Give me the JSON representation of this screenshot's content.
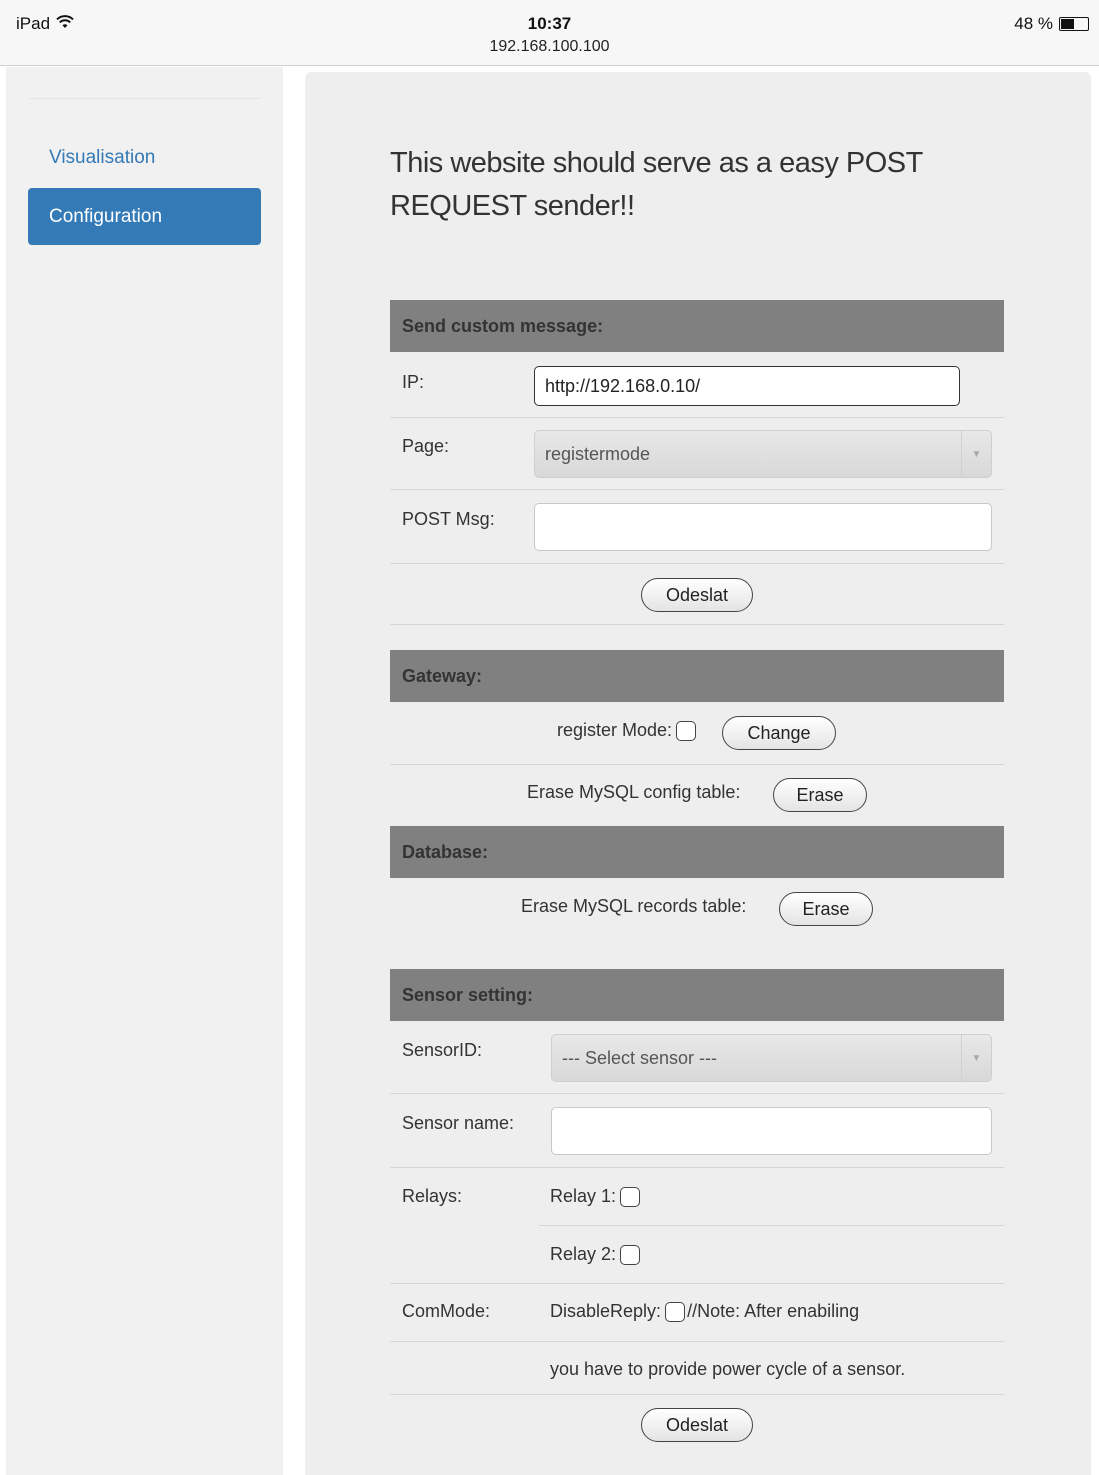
{
  "status_bar": {
    "device": "iPad",
    "time": "10:37",
    "url": "192.168.100.100",
    "battery": "48 %"
  },
  "sidebar": {
    "items": [
      {
        "label": "Visualisation",
        "active": false
      },
      {
        "label": "Configuration",
        "active": true
      }
    ]
  },
  "main": {
    "headline": "This website should serve as a easy POST REQUEST sender!!",
    "custom_message": {
      "title": "Send custom message:",
      "ip_label": "IP:",
      "ip_value": "http://192.168.0.10/",
      "page_label": "Page:",
      "page_value": "registermode",
      "post_label": "POST Msg:",
      "post_value": "",
      "submit": "Odeslat"
    },
    "gateway": {
      "title": "Gateway:",
      "register_mode_label": "register Mode:",
      "change_button": "Change",
      "erase_config_label": "Erase MySQL config table:",
      "erase_config_button": "Erase"
    },
    "database": {
      "title": "Database:",
      "erase_records_label": "Erase MySQL records table:",
      "erase_records_button": "Erase"
    },
    "sensor": {
      "title": "Sensor setting:",
      "sensor_id_label": "SensorID:",
      "sensor_id_value": "--- Select sensor ---",
      "sensor_name_label": "Sensor name:",
      "sensor_name_value": "",
      "relays_label": "Relays:",
      "relay1_label": "Relay 1:",
      "relay2_label": "Relay 2:",
      "commode_label": "ComMode:",
      "disable_reply_label": "DisableReply:",
      "note_part1": "//Note: After enabiling",
      "note_part2": "you have to provide power cycle of a sensor.",
      "submit": "Odeslat"
    }
  }
}
